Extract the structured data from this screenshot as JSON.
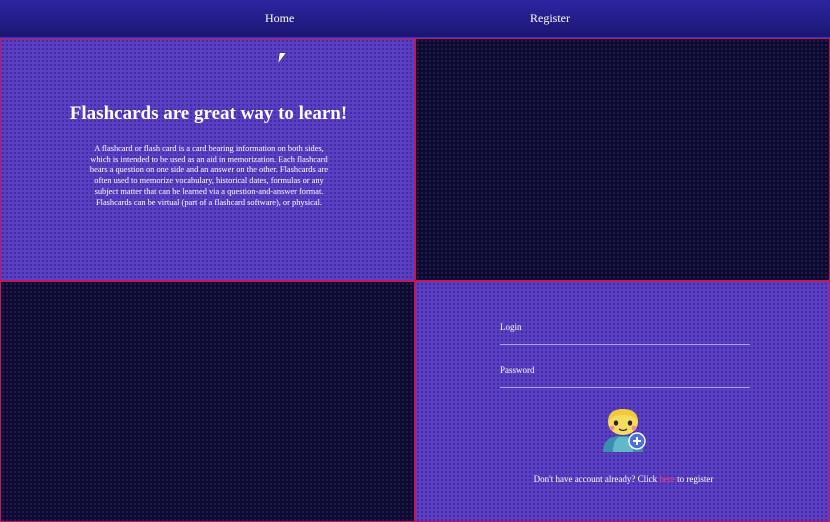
{
  "nav": {
    "home_label": "Home",
    "register_label": "Register"
  },
  "hero": {
    "title": "Flashcards are great way to learn!",
    "text": "A flashcard or flash card is a card bearing information on both sides, which is intended to be used as an aid in memorization. Each flashcard bears a question on one side and an answer on the other. Flashcards are often used to memorize vocabulary, historical dates, formulas or any subject matter that can be learned via a question-and-answer format. Flashcards can be virtual (part of a flashcard software), or physical."
  },
  "login_form": {
    "login_label": "Login",
    "login_value": "",
    "password_label": "Password",
    "password_value": "",
    "avatar_icon": "add-user-icon",
    "register_prefix": "Don't have account already? Click ",
    "register_link_label": "here",
    "register_suffix": " to register"
  },
  "colors": {
    "nav_bg": "#221c86",
    "panel_purple": "#5a3fc4",
    "panel_dark": "#0c0a2e",
    "panel_border": "#c2185b",
    "link_accent": "#ff3d7f"
  }
}
